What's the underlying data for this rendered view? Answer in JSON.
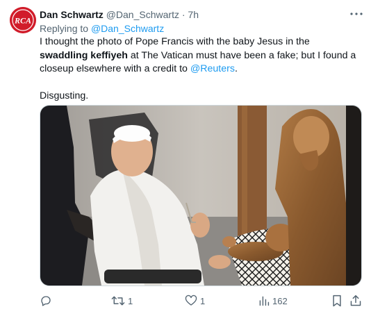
{
  "author": {
    "name": "Dan Schwartz",
    "handle": "@Dan_Schwartz",
    "separator": "·",
    "time": "7h",
    "avatar_text": "RCA"
  },
  "reply_context": {
    "prefix": "Replying to",
    "mention": "@Dan_Schwartz"
  },
  "body": {
    "line1_part1": "I thought the photo of Pope Francis with the baby Jesus in the ",
    "line1_bold": "swaddling keffiyeh",
    "line1_part2": " at The Vatican must have been a fake; but I found a closeup elsewhere with a credit to ",
    "line1_link": "@Reuters",
    "line1_end": ".",
    "line2": "Disgusting."
  },
  "media": {
    "icon": "photo"
  },
  "actions": {
    "reply": {
      "icon": "reply-icon",
      "count": ""
    },
    "retweet": {
      "icon": "retweet-icon",
      "count": "1"
    },
    "like": {
      "icon": "heart-icon",
      "count": "1"
    },
    "views": {
      "icon": "views-icon",
      "count": "162"
    },
    "bookmark": {
      "icon": "bookmark-icon"
    },
    "share": {
      "icon": "share-icon"
    }
  },
  "colors": {
    "accent": "#1d9bf0",
    "muted": "#536471",
    "text": "#0f1419",
    "avatar_bg": "#d11c2a"
  }
}
